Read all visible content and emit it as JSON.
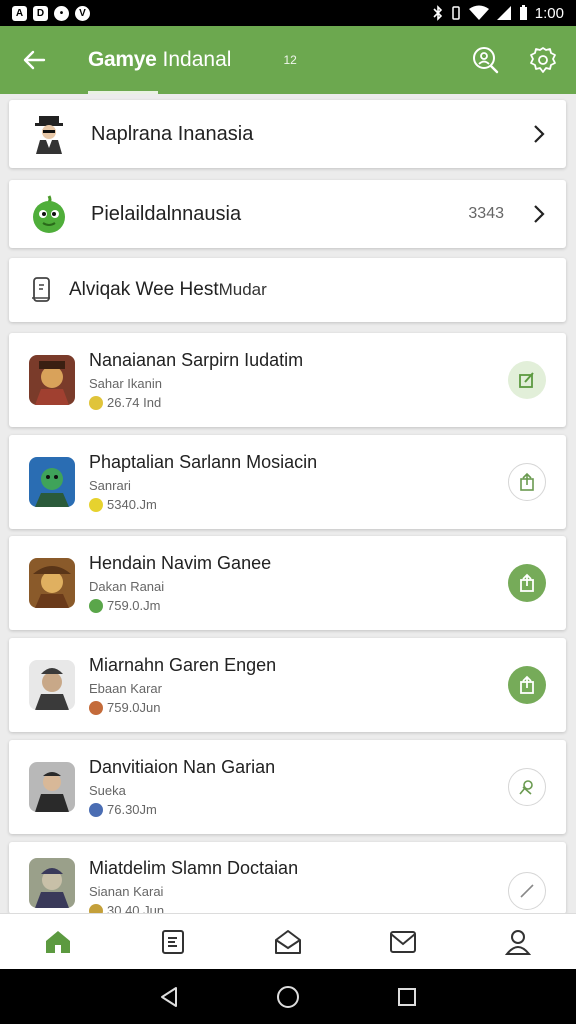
{
  "status_bar": {
    "left_icons": [
      "A",
      "D",
      "•",
      "V"
    ],
    "time": "1:00"
  },
  "app_bar": {
    "title": "Gamye",
    "title_rest": "Indanal",
    "badge": "12"
  },
  "nav_cards": [
    {
      "label": "Naplrana Inanasia",
      "value": "",
      "icon": "character-avatar-icon"
    },
    {
      "label": "Pielaildalnnausia",
      "value": "3343",
      "icon": "green-bird-icon"
    }
  ],
  "sort_card": {
    "label": "Alviqak Wee Hest",
    "action": "Mudar"
  },
  "games": [
    {
      "title": "Nanaianan Sarpirn Iudatim",
      "subtitle": "Sahar Ikanin",
      "meta": "26.74 Ind",
      "meta_color": "#e0c43a",
      "action": "light",
      "action_icon": "edit-icon",
      "thumb_colors": [
        "#7a3b2a",
        "#d9a25a"
      ]
    },
    {
      "title": "Phaptalian Sarlann Mosiacin",
      "subtitle": "Sanrari",
      "meta": "5340.Jm",
      "meta_color": "#e6d22e",
      "action": "outline",
      "action_icon": "share-icon",
      "thumb_colors": [
        "#2a6db3",
        "#3fa35a"
      ]
    },
    {
      "title": "Hendain Navim Ganee",
      "subtitle": "Dakan Ranai",
      "meta": "759.0.Jm",
      "meta_color": "#5aa64a",
      "action": "filled",
      "action_icon": "share-icon",
      "thumb_colors": [
        "#8a5a2a",
        "#e0b060"
      ]
    },
    {
      "title": "Miarnahn Garen Engen",
      "subtitle": "Ebaan Karar",
      "meta": "759.0Jun",
      "meta_color": "#c46b3a",
      "action": "filled",
      "action_icon": "share-icon",
      "thumb_colors": [
        "#3a3a3a",
        "#9aa0a6"
      ]
    },
    {
      "title": "Danvitiaion Nan Garian",
      "subtitle": "Sueka",
      "meta": "76.30Jm",
      "meta_color": "#4a6db3",
      "action": "outline",
      "action_icon": "tag-icon",
      "thumb_colors": [
        "#2a2a2a",
        "#b8b8b8"
      ]
    },
    {
      "title": "Miatdelim Slamn Doctaian",
      "subtitle": "Sianan Karai",
      "meta": "30.40 Jun",
      "meta_color": "#c4a03a",
      "action": "outline",
      "action_icon": "pen-icon",
      "thumb_colors": [
        "#3a3a5a",
        "#9aa08a"
      ]
    }
  ],
  "colors": {
    "primary": "#6ca84f",
    "primary_light": "#e2efd9"
  }
}
